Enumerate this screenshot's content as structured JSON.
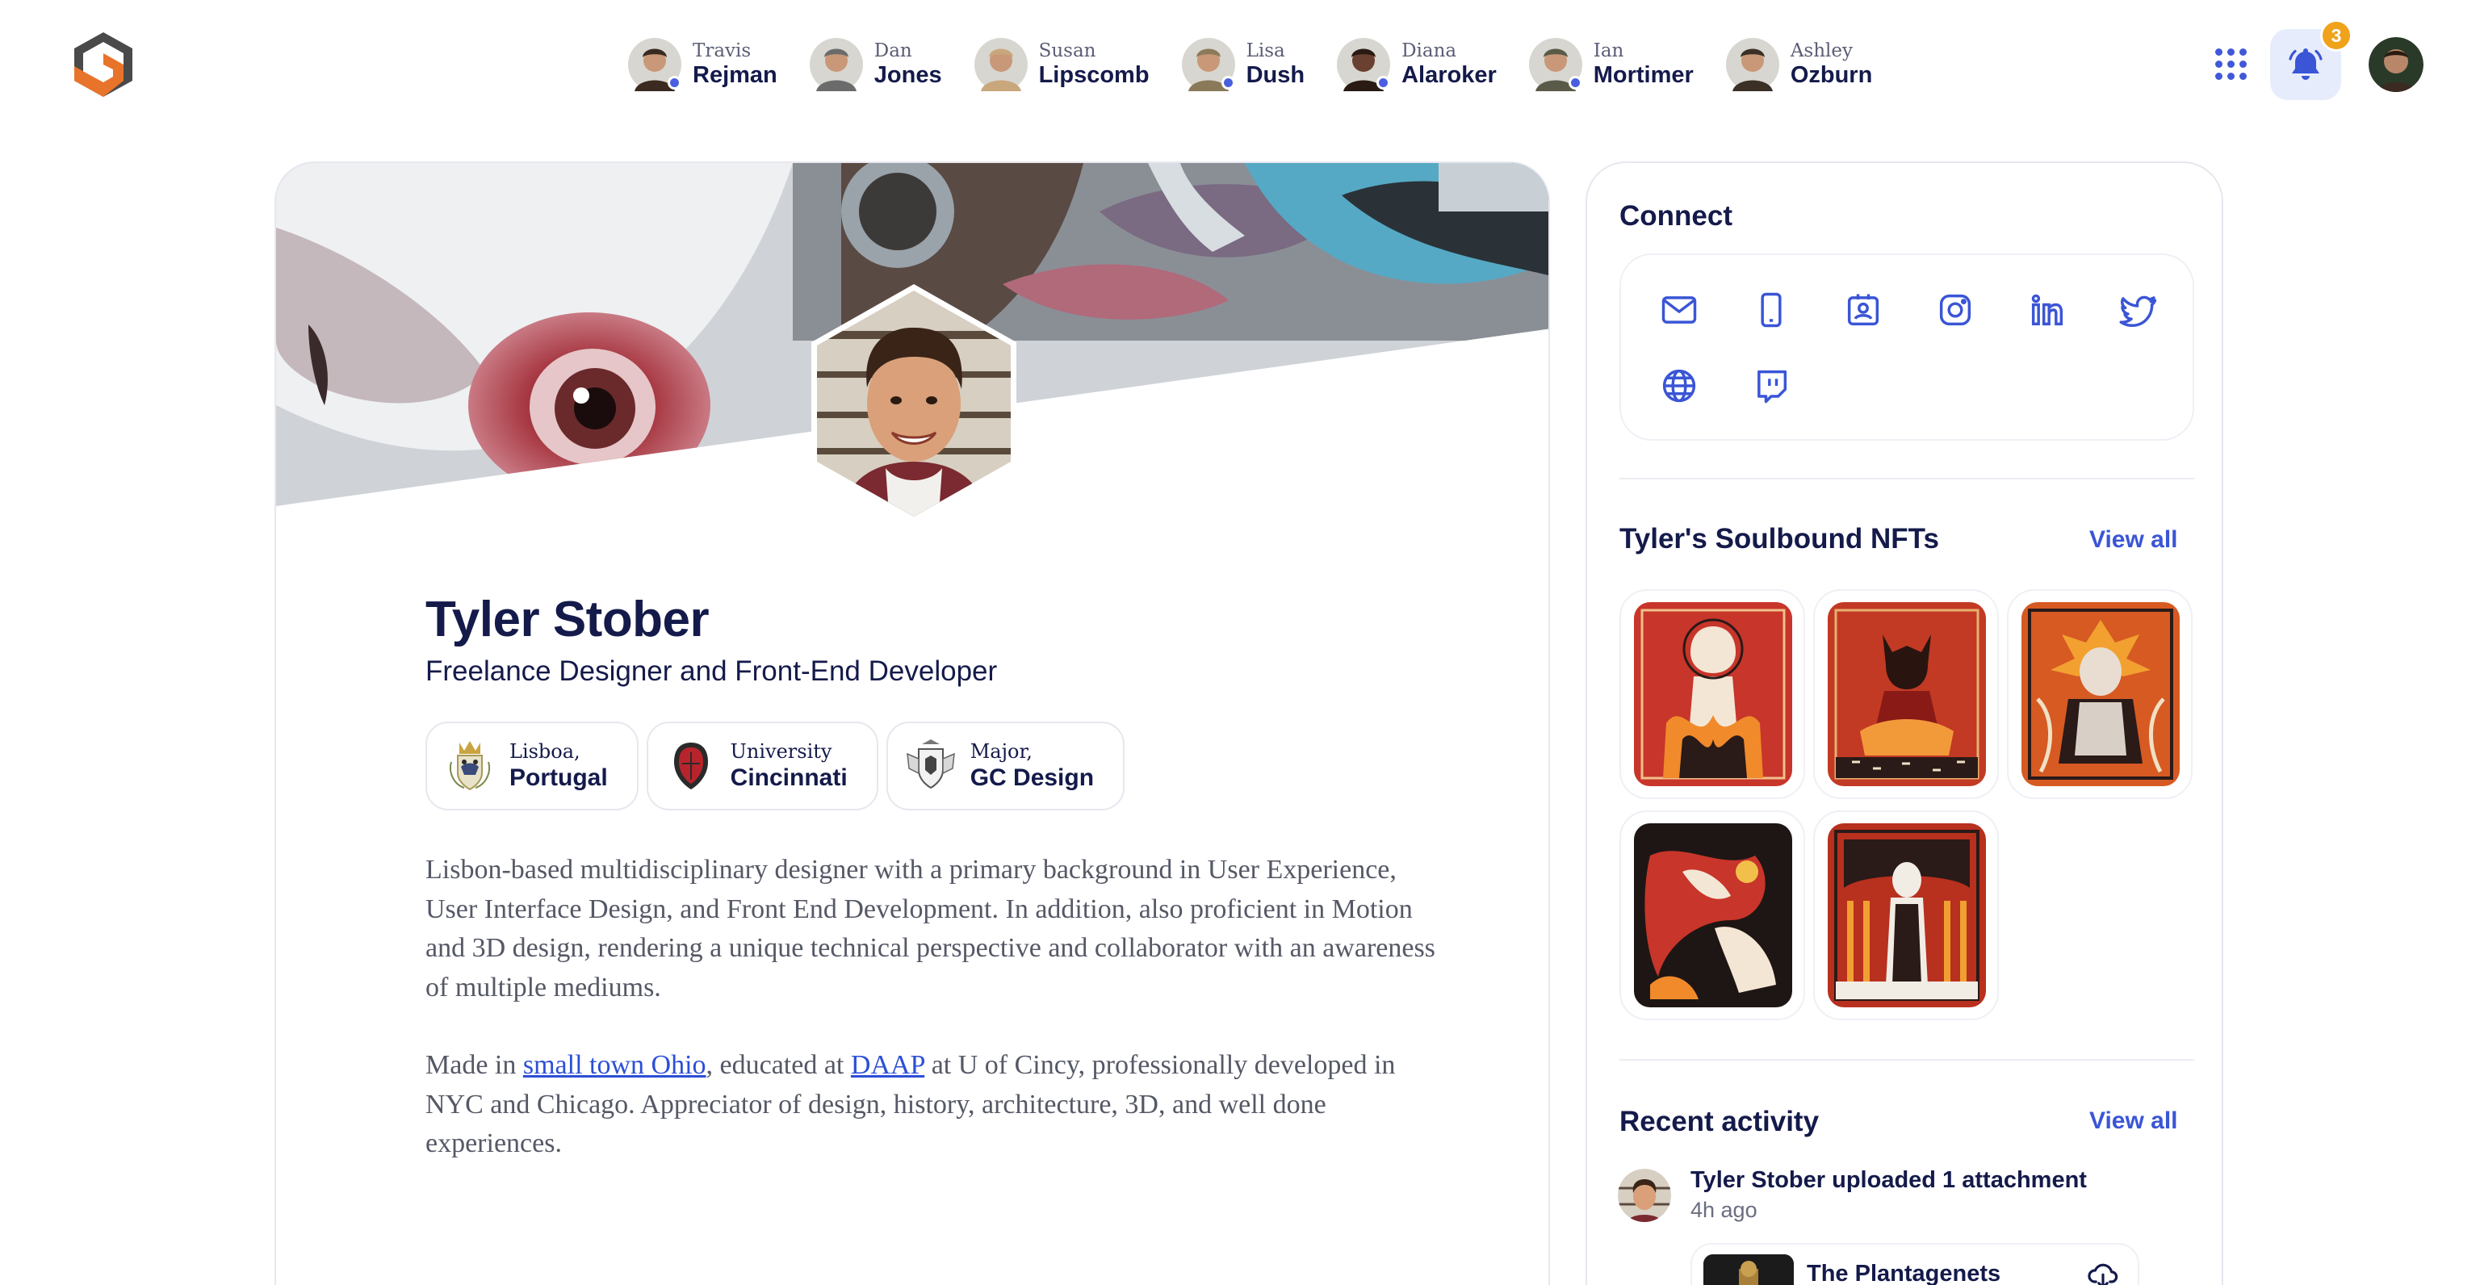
{
  "top_people": [
    {
      "first": "Travis",
      "last": "Rejman",
      "online": true,
      "color": "#3a2a20"
    },
    {
      "first": "Dan",
      "last": "Jones",
      "online": false,
      "color": "#6b6b6b"
    },
    {
      "first": "Susan",
      "last": "Lipscomb",
      "online": false,
      "color": "#c9a77d"
    },
    {
      "first": "Lisa",
      "last": "Dush",
      "online": true,
      "color": "#8a7a5a"
    },
    {
      "first": "Diana",
      "last": "Alaroker",
      "online": true,
      "color": "#2a1a14"
    },
    {
      "first": "Ian",
      "last": "Mortimer",
      "online": true,
      "color": "#5a5a48"
    },
    {
      "first": "Ashley",
      "last": "Ozburn",
      "online": false,
      "color": "#3a3026"
    }
  ],
  "notifications": {
    "count": "3"
  },
  "profile": {
    "name": "Tyler Stober",
    "title": "Freelance Designer and Front-End Developer",
    "chips": [
      {
        "line1": "Lisboa,",
        "line2": "Portugal",
        "emblem": "lisbon-crest-icon"
      },
      {
        "line1": "University",
        "line2": "Cincinnati",
        "emblem": "university-seal-icon"
      },
      {
        "line1": "Major,",
        "line2": "GC Design",
        "emblem": "daap-crest-icon"
      }
    ],
    "bio_p1": "Lisbon-based multidisciplinary designer with a primary background in User Experience, User Interface Design, and Front End Development. In addition, also proficient in Motion and 3D design, rendering a unique technical perspective and collaborator with an awareness of multiple mediums.",
    "bio_p2_a": "Made in ",
    "bio_p2_link1": "small town Ohio",
    "bio_p2_b": ", educated at ",
    "bio_p2_link2": "DAAP",
    "bio_p2_c": " at U of Cincy, professionally developed in NYC and Chicago. Appreciator of design, history, architecture, 3D, and well done experiences."
  },
  "connect": {
    "title": "Connect",
    "icons": [
      "mail-icon",
      "phone-icon",
      "contact-card-icon",
      "instagram-icon",
      "linkedin-icon",
      "twitter-icon",
      "globe-icon",
      "twitch-icon"
    ]
  },
  "nfts": {
    "title": "Tyler's Soulbound NFTs",
    "view_all": "View all",
    "count": 5
  },
  "activity": {
    "title": "Recent activity",
    "view_all": "View all",
    "item_text": "Tyler Stober uploaded 1 attachment",
    "item_time": "4h ago",
    "attachment_title": "The Plantagenets"
  },
  "colors": {
    "accent": "#3a55d6",
    "ink": "#141a4a",
    "badge": "#f0a21a",
    "logo_orange": "#e8732a",
    "logo_gray": "#4a4a4a"
  }
}
